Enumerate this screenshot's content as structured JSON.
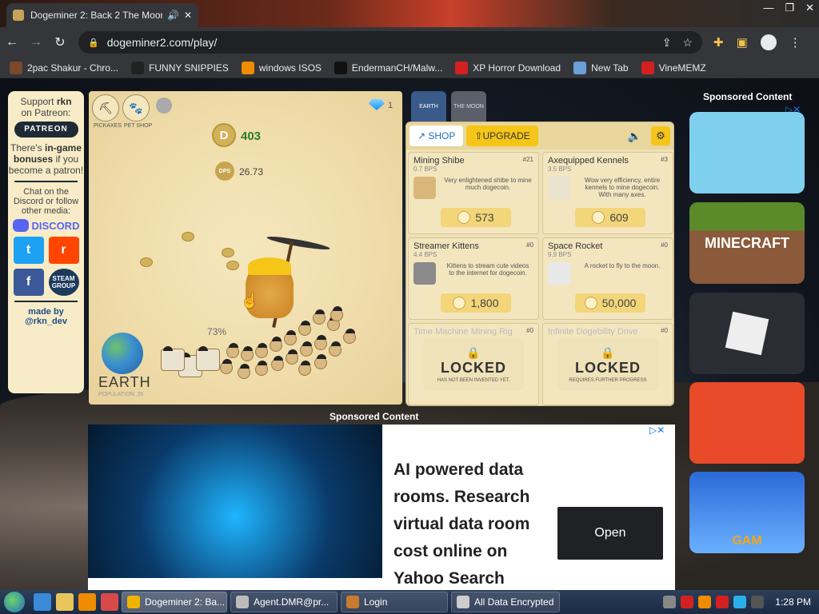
{
  "browser": {
    "tab_title": "Dogeminer 2: Back 2 The Moon",
    "url": "dogeminer2.com/play/"
  },
  "bookmarks": [
    {
      "label": "2pac Shakur - Chro...",
      "color": "#7a4a2a"
    },
    {
      "label": "FUNNY SNIPPIES",
      "color": "#222222"
    },
    {
      "label": "windows ISOS",
      "color": "#f08c00"
    },
    {
      "label": "EndermanCH/Malw...",
      "color": "#111111"
    },
    {
      "label": "XP Horror Download",
      "color": "#d42020"
    },
    {
      "label": "New Tab",
      "color": "#6aa0d8"
    },
    {
      "label": "VineMEMZ",
      "color": "#d42020"
    }
  ],
  "left_panel": {
    "support_prefix": "Support",
    "support_name": "rkn",
    "support_suffix": "on Patreon:",
    "patreon_button": "PATREON",
    "bonus_text_1": "There's",
    "bonus_text_2": "in-game bonuses",
    "bonus_text_3": "if you become a patron!",
    "chat_text": "Chat on the Discord or follow other media:",
    "discord_label": "DISCORD",
    "steam_label": "STEAM GROUP",
    "made_by": "made by",
    "author": "@rkn_dev"
  },
  "game": {
    "coins": "403",
    "dps_label": "DPS",
    "dps_value": "26.73",
    "gems": "1",
    "progress": "73%",
    "planet": "EARTH",
    "population": "POPULATION: 26",
    "tool_labels": [
      "PICKAXES",
      "PET SHOP"
    ],
    "location_tabs": [
      "EARTH",
      "THE MOON"
    ]
  },
  "shop": {
    "tab_shop": "SHOP",
    "tab_upgrade": "UPGRADE",
    "items": [
      {
        "name": "Mining Shibe",
        "count": "#21",
        "bps": "0.7 BPS",
        "desc": "Very enlightened shibe to mine much dogecoin.",
        "price": "573"
      },
      {
        "name": "Axequipped Kennels",
        "count": "#3",
        "bps": "3.5 BPS",
        "desc": "Wow very efficiency, entire kennels to mine dogecoin. With many axes.",
        "price": "609"
      },
      {
        "name": "Streamer Kittens",
        "count": "#0",
        "bps": "4.4 BPS",
        "desc": "Kittens to stream cute videos to the internet for dogecoin.",
        "price": "1,800"
      },
      {
        "name": "Space Rocket",
        "count": "#0",
        "bps": "9.9 BPS",
        "desc": "A rocket to fly to the moon.",
        "price": "50,000"
      }
    ],
    "locked": [
      {
        "name": "Time Machine Mining Rig",
        "count": "#0",
        "title": "LOCKED",
        "sub": "HAS NOT BEEN INVENTED YET."
      },
      {
        "name": "Infinite Dogebility Drive",
        "count": "#0",
        "title": "LOCKED",
        "sub": "REQUIRES FURTHER PROGRESS"
      }
    ]
  },
  "sponsored": {
    "title": "Sponsored Content",
    "bottom_title": "Sponsored Content",
    "ads": [
      {
        "name": "toca-boca",
        "color": "#7fd0ee"
      },
      {
        "name": "minecraft",
        "color": "#5a8a2a",
        "label": "MINECRAFT"
      },
      {
        "name": "roblox",
        "color": "#2a2d33"
      },
      {
        "name": "subway-surfers",
        "color": "#e84a2a"
      },
      {
        "name": "temple-run",
        "color": "#2a6ad8",
        "label": "GAM"
      }
    ]
  },
  "bottom_ad": {
    "headline": "AI powered data rooms. Research virtual data room cost online on Yahoo Search",
    "button": "Open"
  },
  "taskbar": {
    "tasks": [
      {
        "label": "Dogeminer 2: Ba...",
        "color": "#f0b400"
      },
      {
        "label": "Agent.DMR@pr...",
        "color": "#bbbbbb"
      },
      {
        "label": "Login",
        "color": "#c87a30"
      },
      {
        "label": "All Data Encrypted",
        "color": "#cccccc"
      }
    ],
    "clock": "1:28 PM"
  }
}
